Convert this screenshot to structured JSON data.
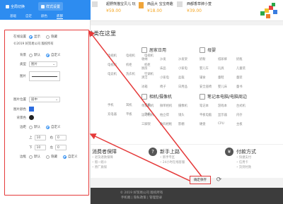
{
  "top_products": {
    "prices": [
      "¥59.00",
      "¥18.00",
      "¥39.00"
    ],
    "names": [
      "超野熊猫宝贝儿 玩",
      "西品大 宝宝奇趣",
      "西都香草牌小萱"
    ]
  },
  "panel": {
    "tabs": [
      "全局切换",
      "样式设置"
    ],
    "sub_tabs": [
      "基础",
      "自定",
      "颜色",
      "底部"
    ],
    "settings": {
      "show_label": "在线设置",
      "show_options": [
        "显示",
        "隐藏"
      ],
      "copyright": "©2019 好贸易公司 版权所有",
      "bg_label": "背景",
      "bg_options": [
        "默认",
        "自定义"
      ],
      "type_label": "类型",
      "type_value": "图片",
      "img_label": "图片",
      "img_pos_label": "图片位置",
      "img_pos_value": "居中",
      "img_color_label": "图片颜色",
      "bg_color_label": "背景色",
      "margin_label": "边距",
      "margin_options": [
        "默认",
        "自定义"
      ],
      "up_label": "上",
      "up_value": "10",
      "right_label": "右",
      "right_value": "0",
      "down_label": "下",
      "down_value": "10",
      "left_label": "左",
      "left_value": "0",
      "border_label": "边框",
      "border_options": [
        "默认",
        "隐藏",
        "自定义"
      ]
    }
  },
  "content": {
    "title": "分类在这里",
    "columns": [
      {
        "title": "",
        "items": [
          "电视机",
          "电视机",
          "电视机",
          "电视机",
          "机柜",
          "机柜",
          "",
          "电竞机",
          "",
          "洗衣机",
          "",
          "",
          "",
          "空调机",
          ""
        ]
      },
      {
        "title": "居家日用",
        "items": [
          "收纳",
          "沙发",
          "沙发架",
          "厨房",
          "床品",
          "小家电",
          "清洁",
          "小家电",
          "盆栽",
          "冰箱",
          "椅子",
          "日用品"
        ]
      },
      {
        "title": "母婴",
        "items": [
          "奶粉",
          "纸尿裤",
          "奶瓶",
          "婴儿车",
          "玩具",
          "儿童装",
          "辅食",
          "童鞋",
          "童装",
          "安全座椅",
          "婴儿床",
          "童书"
        ]
      }
    ],
    "row2": [
      {
        "title": "",
        "items": [
          "手机",
          "手机",
          "手机",
          "手机",
          "耳机",
          "平板",
          "充电器",
          "充电器",
          "平板"
        ]
      },
      {
        "title": "相机/摄像机",
        "items": [
          "单反相机",
          "微单相机",
          "摄像机",
          "运动相机",
          "拍立得",
          "镜头",
          "三脚架",
          "数码相框",
          "影棚"
        ]
      },
      {
        "title": "笔记本电脑/电脑周边",
        "items": [
          "笔记本",
          "游戏本",
          "台式机",
          "平板电脑",
          "显示器",
          "内存",
          "硬盘",
          "CPU",
          "主板"
        ]
      }
    ]
  },
  "services": [
    {
      "icon": "✓",
      "title": "消费者保障",
      "lines": [
        "退货退款保障",
        "假一赔十",
        "原厂质保"
      ]
    },
    {
      "icon": "?",
      "title": "新手上路",
      "lines": [
        "新手专区",
        "24小时在线客服",
        ""
      ]
    },
    {
      "icon": "¥",
      "title": "付款方式",
      "lines": [
        "快捷支付",
        "信用卡",
        "货到付款"
      ]
    }
  ],
  "footer": {
    "line1": "© 2019 好贸易公司 版权所有",
    "line2": "手机端 | 隐私政策 | 管理登录"
  },
  "save_button": "确定保存",
  "colors": {
    "accent": "#2d8cf0",
    "highlight": "#e53a3a",
    "price": "#f5a623",
    "img_color": "#2d6cdf",
    "bg_color": "#222222"
  }
}
